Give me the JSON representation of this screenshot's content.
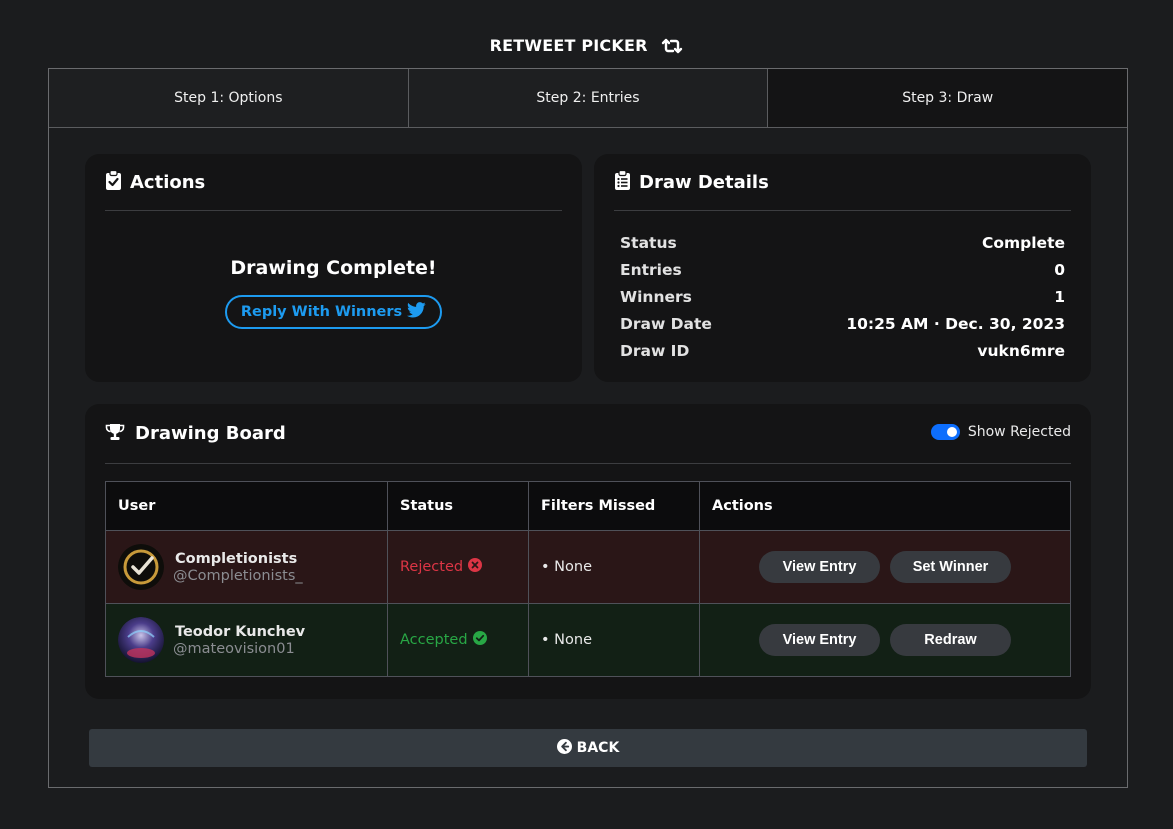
{
  "app": {
    "title": "RETWEET PICKER",
    "title_icon": "retweet-icon"
  },
  "tabs": [
    {
      "label": "Step 1: Options",
      "active": false
    },
    {
      "label": "Step 2: Entries",
      "active": false
    },
    {
      "label": "Step 3: Draw",
      "active": true
    }
  ],
  "actions_card": {
    "title": "Actions",
    "icon": "clipboard-check-icon",
    "complete_text": "Drawing Complete!",
    "reply_button": "Reply With Winners",
    "reply_icon": "twitter-icon"
  },
  "details_card": {
    "title": "Draw Details",
    "icon": "clipboard-list-icon",
    "rows": [
      {
        "label": "Status",
        "value": "Complete"
      },
      {
        "label": "Entries",
        "value": "0"
      },
      {
        "label": "Winners",
        "value": "1"
      },
      {
        "label": "Draw Date",
        "value": "10:25 AM · Dec. 30, 2023"
      },
      {
        "label": "Draw ID",
        "value": "vukn6mre"
      }
    ]
  },
  "board": {
    "title": "Drawing Board",
    "icon": "trophy-icon",
    "toggle_label": "Show Rejected",
    "toggle_on": true,
    "columns": [
      "User",
      "Status",
      "Filters Missed",
      "Actions"
    ],
    "rows": [
      {
        "name": "Completionists",
        "handle": "@Completionists_",
        "status": "Rejected",
        "status_icon": "x-circle-icon",
        "filters": "• None",
        "buttons": [
          "View Entry",
          "Set Winner"
        ]
      },
      {
        "name": "Teodor Kunchev",
        "handle": "@mateovision01",
        "status": "Accepted",
        "status_icon": "check-circle-icon",
        "filters": "• None",
        "buttons": [
          "View Entry",
          "Redraw"
        ]
      }
    ]
  },
  "back_button": {
    "label": "BACK",
    "icon": "arrow-left-circle-icon"
  },
  "colors": {
    "accent": "#1d9bf0",
    "rejected": "#dc3545",
    "accepted": "#28a745",
    "toggle": "#0d6efd"
  }
}
